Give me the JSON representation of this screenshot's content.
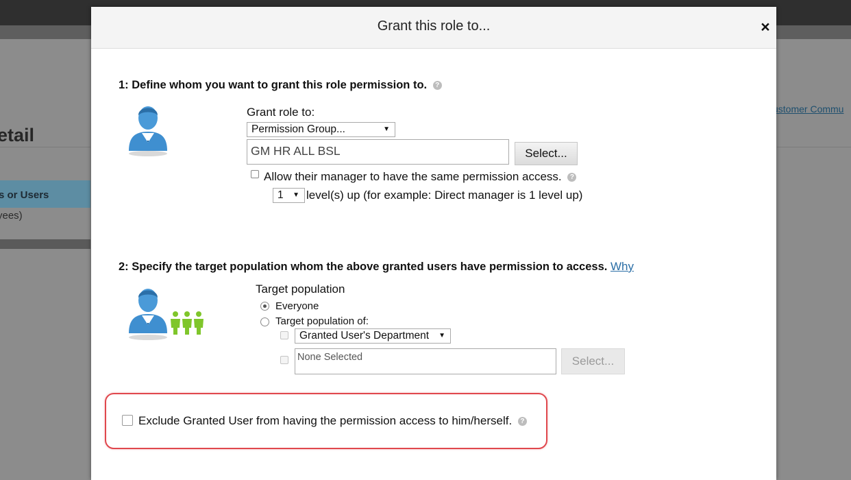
{
  "background": {
    "page_title_partial": "etail",
    "nav_item_partial": "s or Users",
    "nav_sub_partial": "yees)",
    "link_partial": "ustomer Commu"
  },
  "modal": {
    "title": "Grant this role to...",
    "close_icon": "×",
    "help_icon": "?",
    "section1": {
      "heading": "1: Define whom you want to grant this role permission to.",
      "grant_role_label": "Grant role to:",
      "grant_role_select": "Permission Group...",
      "group_value": "GM HR ALL BSL",
      "select_button": "Select...",
      "manager_checkbox_label": "Allow their manager to have the same permission access.",
      "manager_checked": false,
      "level_select": "1",
      "level_text": "level(s) up (for example: Direct manager is 1 level up)"
    },
    "section2": {
      "heading": "2: Specify the target population whom the above granted users have permission to access.",
      "why_link": "Why",
      "target_label": "Target population",
      "option_everyone": "Everyone",
      "option_target_of": "Target population of:",
      "selected_option": "Everyone",
      "department_select": "Granted User's Department",
      "none_selected_placeholder": "None Selected",
      "select_button": "Select..."
    },
    "exclude_label": "Exclude Granted User from having the permission access to him/herself.",
    "exclude_checked": false,
    "colors": {
      "highlight_border": "#e0474d",
      "link": "#2a6ea6",
      "person_icon_blue": "#3f8fd0",
      "population_icon_green": "#7fc62b"
    }
  }
}
